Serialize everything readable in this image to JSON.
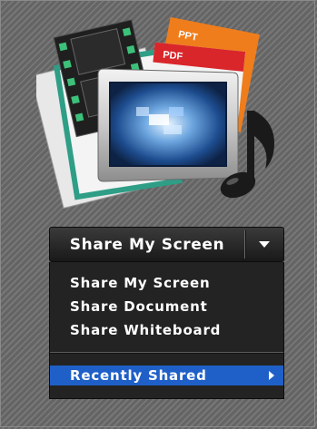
{
  "share_bar": {
    "button_label": "Share My Screen",
    "dropdown_icon": "caret-down-icon"
  },
  "menu": {
    "items": [
      {
        "label": "Share My Screen"
      },
      {
        "label": "Share Document"
      },
      {
        "label": "Share Whiteboard"
      }
    ],
    "recent": {
      "label": "Recently Shared",
      "icon": "chevron-right-icon"
    }
  },
  "hero": {
    "doc_badges": [
      "PPT",
      "PDF"
    ],
    "icons": [
      "film-strip-icon",
      "document-stack-icon",
      "monitor-icon",
      "music-note-icon"
    ]
  },
  "colors": {
    "background": "#6d6d6d",
    "menu_bg": "#232323",
    "highlight": "#1f60c8",
    "ppt_orange": "#ef7d1c",
    "pdf_red": "#d9262a"
  }
}
